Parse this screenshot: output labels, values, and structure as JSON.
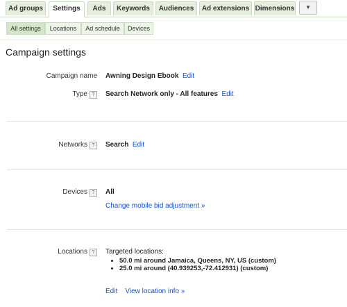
{
  "tabs": [
    {
      "label": "Ad groups"
    },
    {
      "label": "Settings"
    },
    {
      "label": "Ads"
    },
    {
      "label": "Keywords"
    },
    {
      "label": "Audiences"
    },
    {
      "label": "Ad extensions"
    },
    {
      "label": "Dimensions"
    }
  ],
  "tabs_more": "▼",
  "subtabs": [
    {
      "label": "All settings"
    },
    {
      "label": "Locations"
    },
    {
      "label": "Ad schedule"
    },
    {
      "label": "Devices"
    }
  ],
  "page_title": "Campaign settings",
  "help_glyph": "?",
  "campaign_name": {
    "label": "Campaign name",
    "value": "Awning Design Ebook",
    "edit": "Edit"
  },
  "type": {
    "label": "Type",
    "value": "Search Network only - All features",
    "edit": "Edit"
  },
  "networks": {
    "label": "Networks",
    "value": "Search",
    "edit": "Edit"
  },
  "devices": {
    "label": "Devices",
    "value": "All",
    "link": "Change mobile bid adjustment »"
  },
  "locations": {
    "label": "Locations",
    "heading": "Targeted locations:",
    "items": [
      "50.0 mi around Jamaica, Queens, NY, US (custom)",
      "25.0 mi around (40.939253,-72.412931) (custom)"
    ],
    "edit": "Edit",
    "view": "View location info »"
  }
}
